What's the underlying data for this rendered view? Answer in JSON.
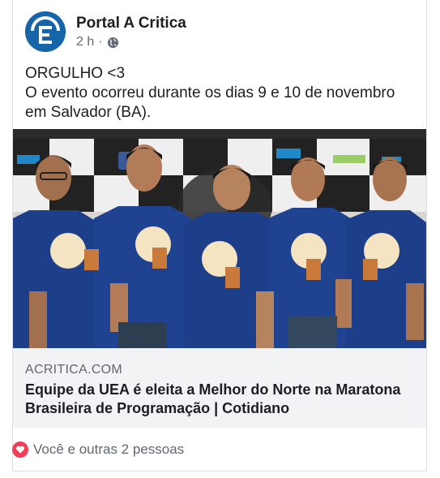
{
  "post": {
    "page_name": "Portal A Critica",
    "time": "2 h",
    "separator": "·",
    "privacy_icon": "globe-icon",
    "text_lines": [
      "ORGULHO <3",
      "O evento ocorreu durante os dias 9 e 10 de novembro",
      "em Salvador (BA)."
    ]
  },
  "link": {
    "domain": "ACRITICA.COM",
    "title_lines": [
      "Equipe da UEA é eleita a Melhor do Norte na Maratona",
      "Brasileira de Programação | Cotidiano"
    ]
  },
  "reactions": {
    "icon": "heart-icon",
    "text": "Você e outras 2 pessoas"
  },
  "colors": {
    "avatar_blue": "#1565a8",
    "link_bg": "#f2f3f5",
    "heart": "#f33e58",
    "shirt": "#1d3f8a"
  }
}
